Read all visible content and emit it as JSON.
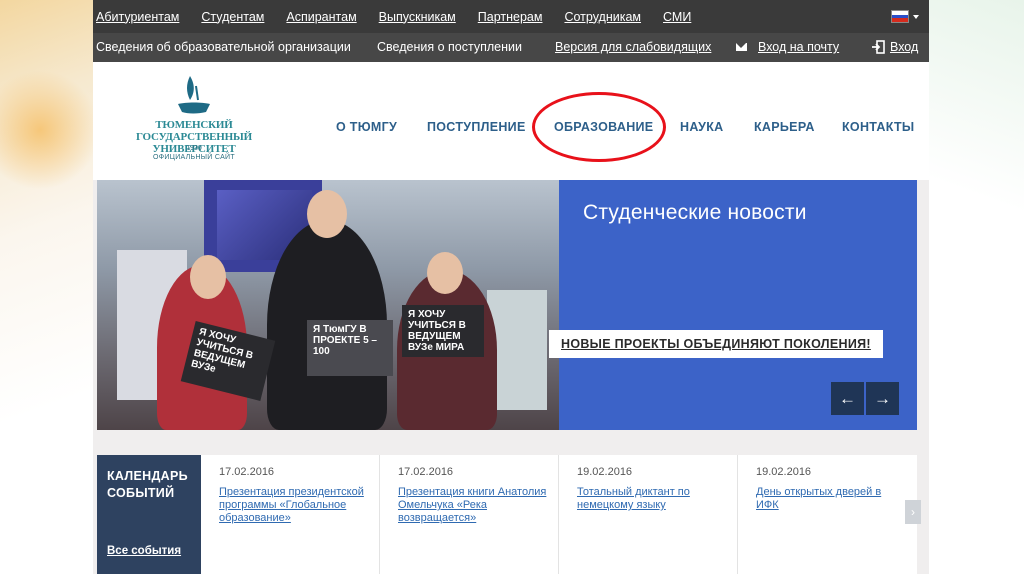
{
  "topbar": {
    "links": [
      "Абитуриентам",
      "Студентам",
      "Аспирантам",
      "Выпускникам",
      "Партнерам",
      "Сотрудникам",
      "СМИ"
    ]
  },
  "infobar": {
    "org_info": "Сведения об образовательной организации",
    "admission_info": "Сведения о поступлении",
    "visually_impaired": "Версия для слабовидящих",
    "mail_login": "Вход на почту",
    "login": "Вход"
  },
  "logo": {
    "name_line1": "ТЮМЕНСКИЙ ГОСУДАРСТВЕННЫЙ",
    "name_line2": "УНИВЕРСИТЕТ",
    "year": "1930",
    "subtitle": "ОФИЦИАЛЬНЫЙ САЙТ"
  },
  "nav": {
    "items": [
      "О ТЮМГУ",
      "ПОСТУПЛЕНИЕ",
      "ОБРАЗОВАНИЕ",
      "НАУКА",
      "КАРЬЕРА",
      "КОНТАКТЫ"
    ]
  },
  "banner": {
    "section_title": "Студенческие новости",
    "headline": "НОВЫЕ ПРОЕКТЫ ОБЪЕДИНЯЮТ ПОКОЛЕНИЯ!",
    "prev": "←",
    "next": "→",
    "signs": [
      "Я ХОЧУ УЧИТЬСЯ В ВЕДУЩЕМ ВУЗе",
      "Я ТюмГУ В ПРОЕКТЕ 5 – 100",
      "Я ХОЧУ УЧИТЬСЯ В ВЕДУЩЕМ ВУЗе МИРА"
    ]
  },
  "events": {
    "calendar_title": "КАЛЕНДАРЬ СОБЫТИЙ",
    "all_events": "Все события",
    "items": [
      {
        "date": "17.02.2016",
        "title": "Презентация президентской программы «Глобальное образование»"
      },
      {
        "date": "17.02.2016",
        "title": "Презентация книги Анатолия Омельчука «Река возвращается»"
      },
      {
        "date": "19.02.2016",
        "title": "Тотальный диктант по немецкому языку"
      },
      {
        "date": "19.02.2016",
        "title": "День открытых дверей в ИФК"
      }
    ],
    "next": "›"
  },
  "colors": {
    "topbar": "#3a3a3a",
    "infobar": "#474747",
    "nav_text": "#2d5f8a",
    "banner_blue": "#3c63c8",
    "calendar": "#2e4260",
    "highlight_circle": "#e8111a"
  }
}
